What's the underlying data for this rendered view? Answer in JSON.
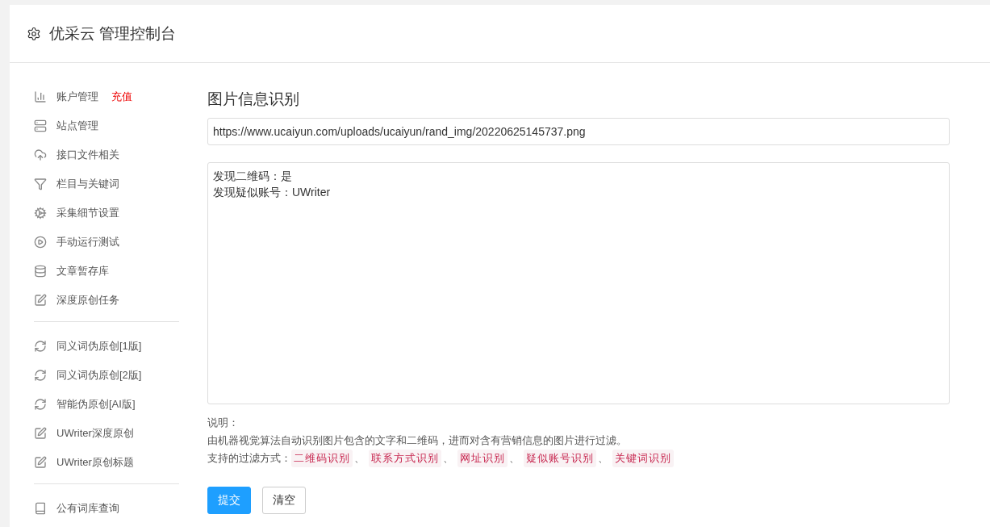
{
  "header": {
    "title": "优采云 管理控制台"
  },
  "sidebar": {
    "groups": [
      {
        "items": [
          {
            "label": "账户管理",
            "badge": "充值"
          },
          {
            "label": "站点管理"
          },
          {
            "label": "接口文件相关"
          },
          {
            "label": "栏目与关键词"
          },
          {
            "label": "采集细节设置"
          },
          {
            "label": "手动运行测试"
          },
          {
            "label": "文章暂存库"
          },
          {
            "label": "深度原创任务"
          }
        ]
      },
      {
        "items": [
          {
            "label": "同义词伪原创[1版]"
          },
          {
            "label": "同义词伪原创[2版]"
          },
          {
            "label": "智能伪原创[AI版]"
          },
          {
            "label": "UWriter深度原创"
          },
          {
            "label": "UWriter原创标题"
          }
        ]
      },
      {
        "items": [
          {
            "label": "公有词库查询"
          }
        ]
      }
    ]
  },
  "main": {
    "title": "图片信息识别",
    "url_field": {
      "value": "https://www.ucaiyun.com/uploads/ucaiyun/rand_img/20220625145737.png"
    },
    "result_box": {
      "lines": [
        "发现二维码：是",
        "发现疑似账号：UWriter"
      ]
    },
    "notes": {
      "heading": "说明：",
      "description": "由机器视觉算法自动识别图片包含的文字和二维码，进而对含有营销信息的图片进行过滤。",
      "methods_label": "支持的过滤方式：",
      "methods": [
        {
          "label": "二维码识别",
          "separator": "、"
        },
        {
          "label": "联系方式识别",
          "separator": "、"
        },
        {
          "label": "网址识别",
          "separator": "、"
        },
        {
          "label": "疑似账号识别",
          "separator": "、"
        },
        {
          "label": "关键词识别"
        }
      ]
    },
    "buttons": [
      {
        "label": "提交",
        "kind": "primary"
      },
      {
        "label": "清空",
        "kind": "default"
      }
    ]
  }
}
